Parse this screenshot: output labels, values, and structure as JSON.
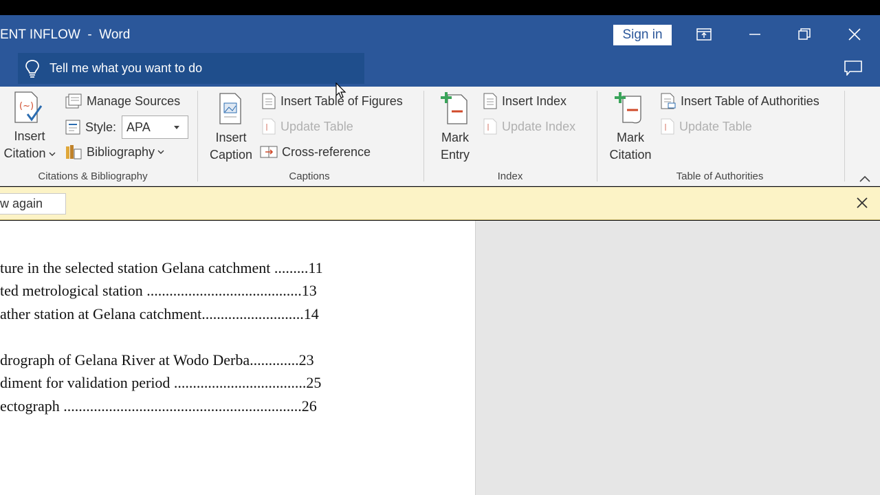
{
  "titlebar": {
    "title": "ENT INFLOW  -  Word",
    "sign_in": "Sign in",
    "tell_me_placeholder": "Tell me what you want to do"
  },
  "ribbon": {
    "citations": {
      "insert_citation_line1": "Insert",
      "insert_citation_line2": "Citation",
      "manage_sources": "Manage Sources",
      "style_label": "Style:",
      "style_value": "APA",
      "bibliography": "Bibliography",
      "group_label": "Citations & Bibliography"
    },
    "captions": {
      "insert_caption_line1": "Insert",
      "insert_caption_line2": "Caption",
      "insert_table_of_figures": "Insert Table of Figures",
      "update_table": "Update Table",
      "cross_reference": "Cross-reference",
      "group_label": "Captions"
    },
    "index": {
      "mark_entry_line1": "Mark",
      "mark_entry_line2": "Entry",
      "insert_index": "Insert Index",
      "update_index": "Update Index",
      "group_label": "Index"
    },
    "authorities": {
      "mark_citation_line1": "Mark",
      "mark_citation_line2": "Citation",
      "insert_table_of_authorities": "Insert Table of Authorities",
      "update_table": "Update Table",
      "group_label": "Table of Authorities"
    }
  },
  "message_bar": {
    "button_label": "w again"
  },
  "document": {
    "lines": [
      "ture in the selected station Gelana catchment .........11",
      "ted metrological station .........................................13",
      "ather station at Gelana catchment...........................14",
      "drograph of Gelana River at Wodo Derba.............23",
      "diment for validation period ...................................25",
      "ectograph ...............................................................26"
    ]
  },
  "colors": {
    "title_blue": "#2b579a",
    "tellme_blue": "#1f4e8c",
    "ribbon_bg": "#f3f3f3",
    "message_bar_bg": "#fcf3c6"
  }
}
